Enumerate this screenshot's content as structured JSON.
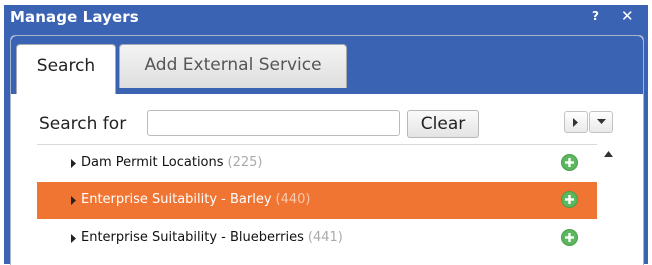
{
  "window": {
    "title": "Manage Layers",
    "help_label": "?",
    "close_label": "✕"
  },
  "tabs": [
    {
      "label": "Search",
      "active": true
    },
    {
      "label": "Add External Service",
      "active": false
    }
  ],
  "search": {
    "label": "Search for",
    "value": "",
    "clear_label": "Clear"
  },
  "layers": [
    {
      "name": "Dam Permit Locations",
      "count": "(225)",
      "selected": false
    },
    {
      "name": "Enterprise Suitability - Barley",
      "count": "(440)",
      "selected": true
    },
    {
      "name": "Enterprise Suitability - Blueberries",
      "count": "(441)",
      "selected": false
    }
  ],
  "icons": {
    "expand": "caret-right-icon",
    "add": "add-circle-icon",
    "menu_right": "caret-right-icon",
    "menu_down": "caret-down-icon",
    "scroll_up": "scroll-up-arrow-icon"
  },
  "colors": {
    "header_blue": "#3b63b3",
    "selected_orange": "#f07533",
    "add_green": "#5cb85c"
  }
}
